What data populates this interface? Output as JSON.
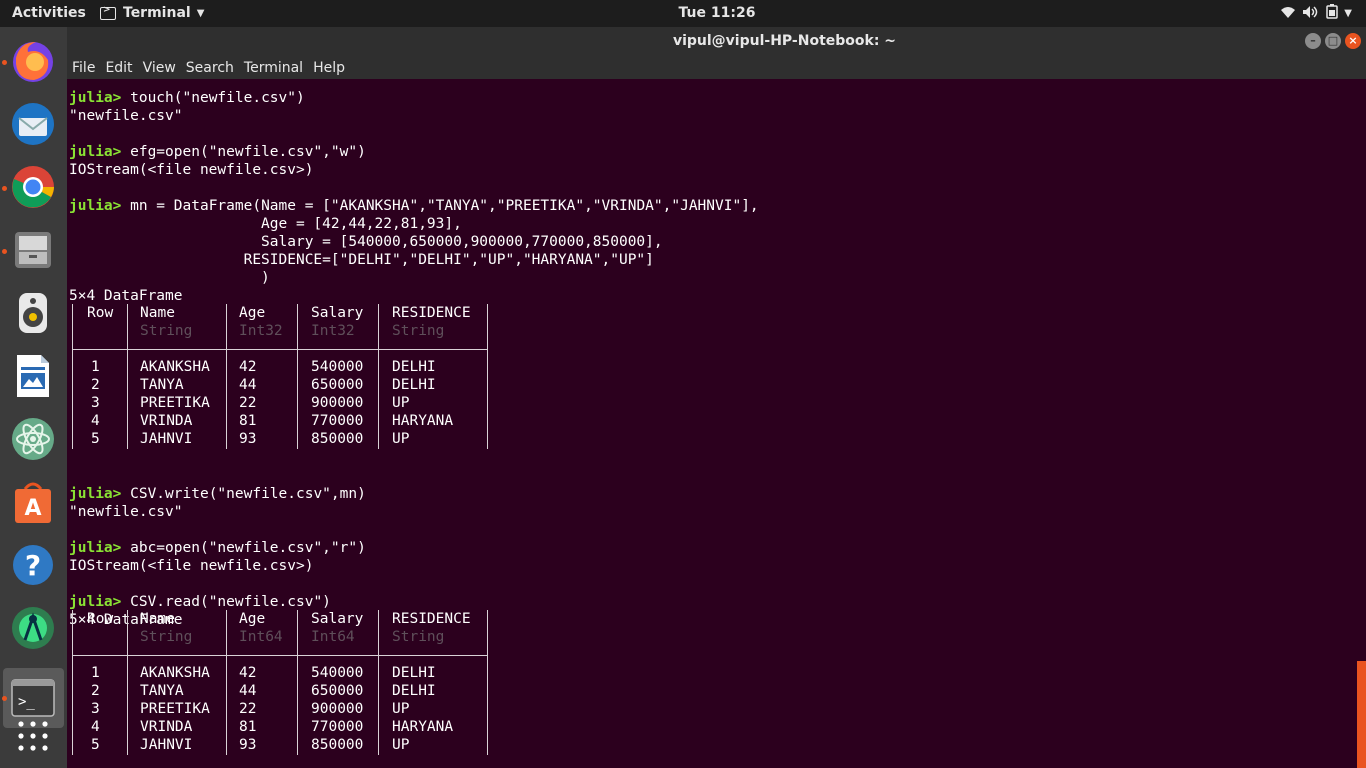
{
  "topbar": {
    "activities": "Activities",
    "app_name": "Terminal",
    "clock": "Tue 11:26"
  },
  "window": {
    "title": "vipul@vipul-HP-Notebook: ~"
  },
  "menu": [
    "File",
    "Edit",
    "View",
    "Search",
    "Terminal",
    "Help"
  ],
  "dock": [
    {
      "name": "firefox",
      "running": true
    },
    {
      "name": "thunderbird",
      "running": false
    },
    {
      "name": "chrome",
      "running": true
    },
    {
      "name": "files",
      "running": true
    },
    {
      "name": "rhythmbox",
      "running": false
    },
    {
      "name": "libreoffice-writer",
      "running": false
    },
    {
      "name": "atom",
      "running": false
    },
    {
      "name": "software-center",
      "running": false
    },
    {
      "name": "help",
      "running": false
    },
    {
      "name": "android-studio",
      "running": false
    },
    {
      "name": "terminal",
      "running": true
    },
    {
      "name": "show-apps",
      "running": false
    }
  ],
  "terminal": {
    "prompt": "julia>",
    "lines": [
      {
        "p": true,
        "t": " touch(\"newfile.csv\")"
      },
      {
        "p": false,
        "t": "\"newfile.csv\""
      },
      {
        "p": false,
        "t": ""
      },
      {
        "p": true,
        "t": " efg=open(\"newfile.csv\",\"w\")"
      },
      {
        "p": false,
        "t": "IOStream(<file newfile.csv>)"
      },
      {
        "p": false,
        "t": ""
      },
      {
        "p": true,
        "t": " mn = DataFrame(Name = [\"AKANKSHA\",\"TANYA\",\"PREETIKA\",\"VRINDA\",\"JAHNVI\"],"
      },
      {
        "p": false,
        "t": "                      Age = [42,44,22,81,93],"
      },
      {
        "p": false,
        "t": "                      Salary = [540000,650000,900000,770000,850000],"
      },
      {
        "p": false,
        "t": "                    RESIDENCE=[\"DELHI\",\"DELHI\",\"UP\",\"HARYANA\",\"UP\"]"
      },
      {
        "p": false,
        "t": "                      )"
      },
      {
        "p": false,
        "t": "5×4 DataFrame"
      },
      {
        "p": false,
        "t": ""
      },
      {
        "p": false,
        "t": ""
      },
      {
        "p": false,
        "t": ""
      },
      {
        "p": false,
        "t": ""
      },
      {
        "p": false,
        "t": ""
      },
      {
        "p": false,
        "t": ""
      },
      {
        "p": false,
        "t": ""
      },
      {
        "p": false,
        "t": ""
      },
      {
        "p": false,
        "t": ""
      },
      {
        "p": false,
        "t": ""
      },
      {
        "p": true,
        "t": " CSV.write(\"newfile.csv\",mn)"
      },
      {
        "p": false,
        "t": "\"newfile.csv\""
      },
      {
        "p": false,
        "t": ""
      },
      {
        "p": true,
        "t": " abc=open(\"newfile.csv\",\"r\")"
      },
      {
        "p": false,
        "t": "IOStream(<file newfile.csv>)"
      },
      {
        "p": false,
        "t": ""
      },
      {
        "p": true,
        "t": " CSV.read(\"newfile.csv\")"
      },
      {
        "p": false,
        "t": "5×4 DataFrame"
      }
    ]
  },
  "tables": [
    {
      "headers": [
        "Row",
        "Name",
        "Age",
        "Salary",
        "RESIDENCE"
      ],
      "types": [
        "",
        "String",
        "Int32",
        "Int32",
        "String"
      ],
      "rows": [
        [
          "1",
          "AKANKSHA",
          "42",
          "540000",
          "DELHI"
        ],
        [
          "2",
          "TANYA",
          "44",
          "650000",
          "DELHI"
        ],
        [
          "3",
          "PREETIKA",
          "22",
          "900000",
          "UP"
        ],
        [
          "4",
          "VRINDA",
          "81",
          "770000",
          "HARYANA"
        ],
        [
          "5",
          "JAHNVI",
          "93",
          "850000",
          "UP"
        ]
      ]
    },
    {
      "headers": [
        "Row",
        "Name",
        "Age",
        "Salary",
        "RESIDENCE"
      ],
      "types": [
        "",
        "String",
        "Int64",
        "Int64",
        "String"
      ],
      "rows": [
        [
          "1",
          "AKANKSHA",
          "42",
          "540000",
          "DELHI"
        ],
        [
          "2",
          "TANYA",
          "44",
          "650000",
          "DELHI"
        ],
        [
          "3",
          "PREETIKA",
          "22",
          "900000",
          "UP"
        ],
        [
          "4",
          "VRINDA",
          "81",
          "770000",
          "HARYANA"
        ],
        [
          "5",
          "JAHNVI",
          "93",
          "850000",
          "UP"
        ]
      ]
    }
  ]
}
